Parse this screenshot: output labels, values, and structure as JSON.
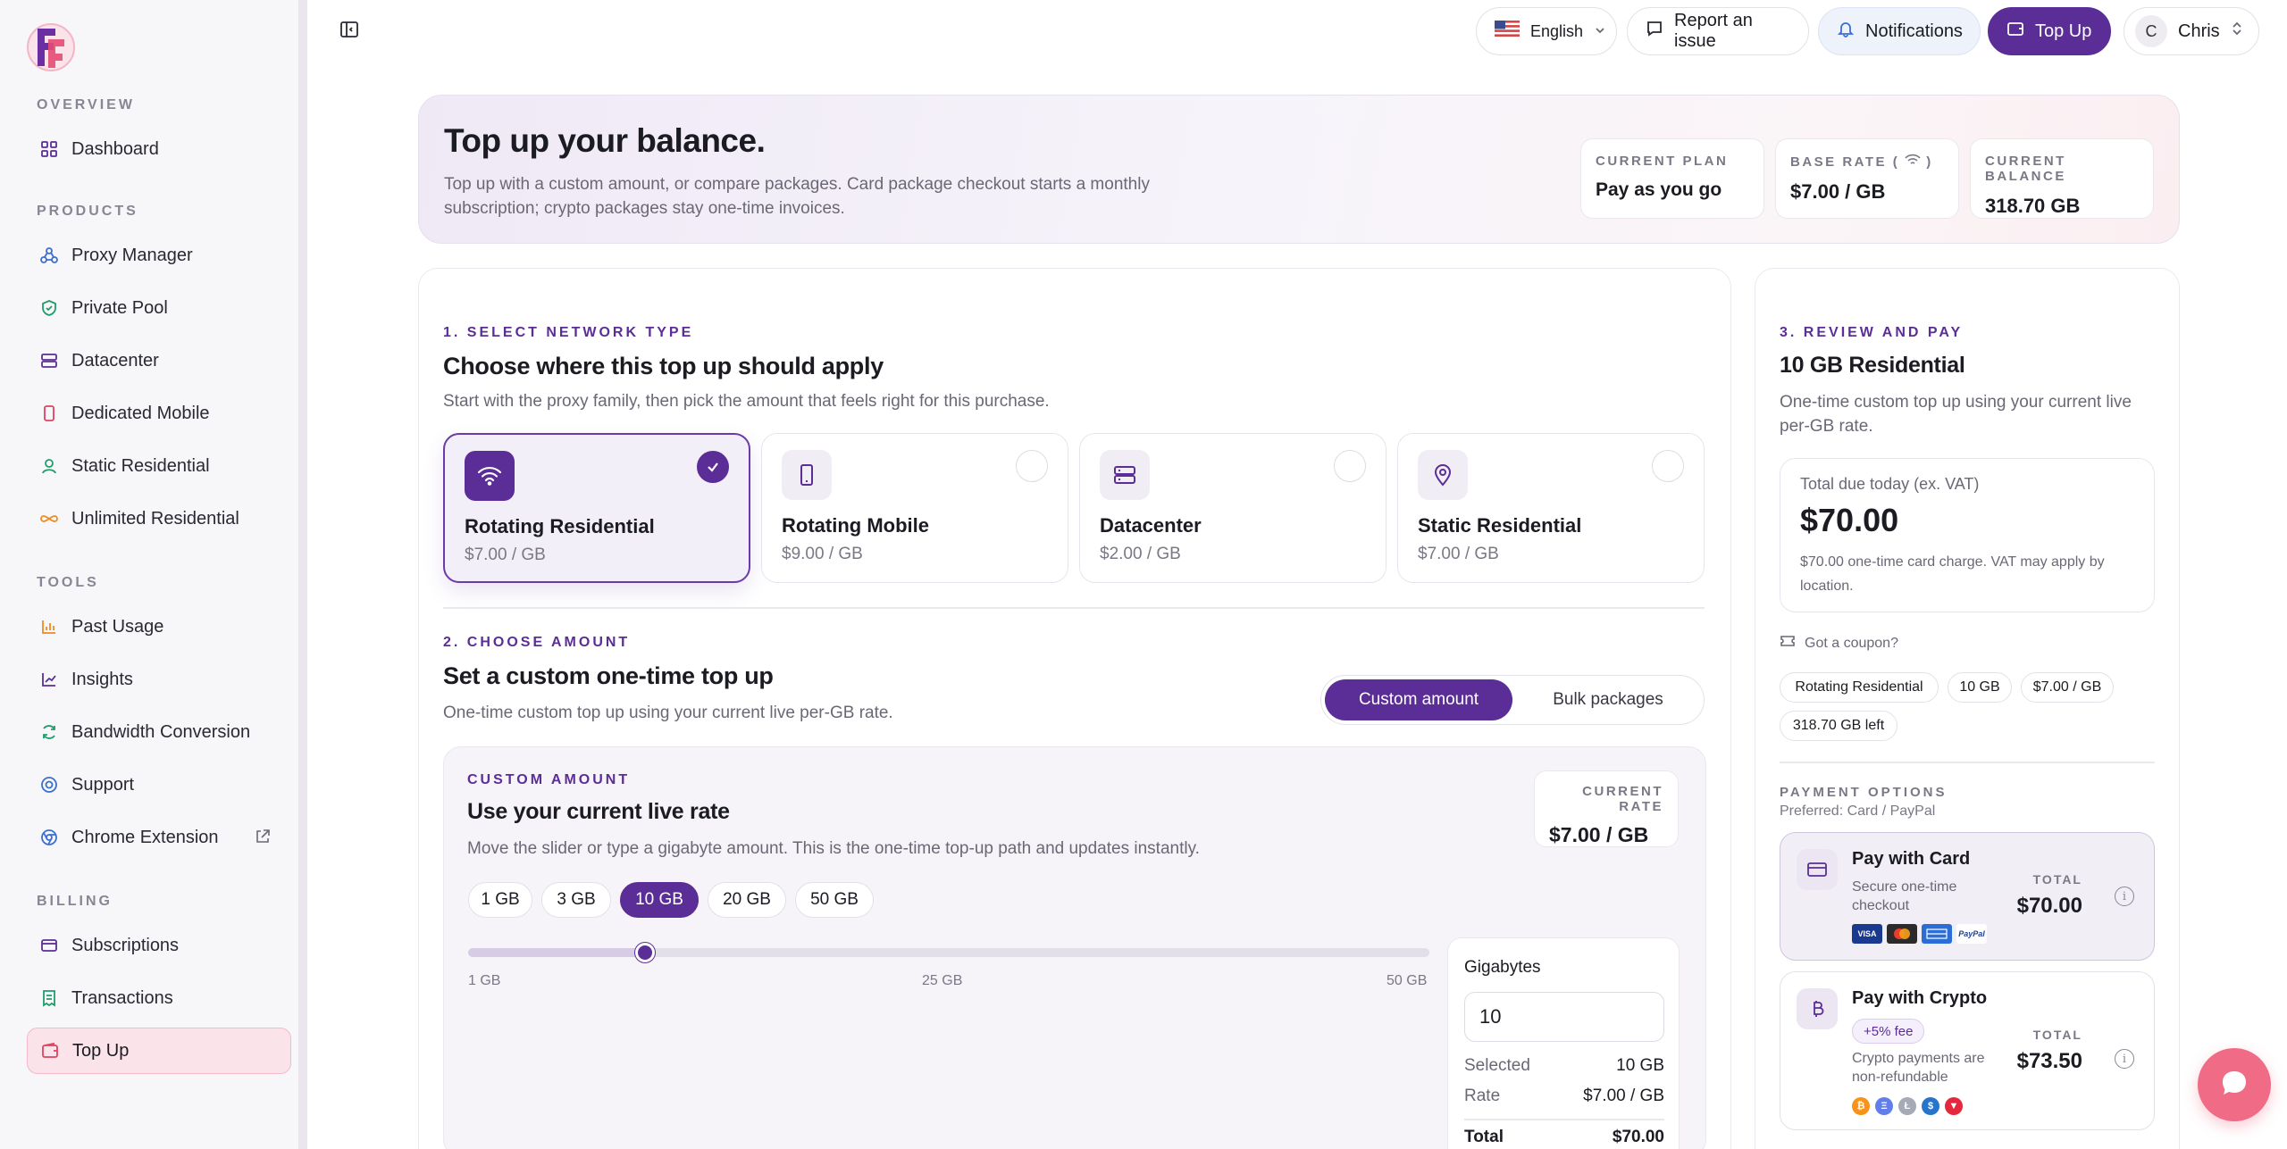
{
  "sidebar": {
    "sections": {
      "overview": "OVERVIEW",
      "products": "PRODUCTS",
      "tools": "TOOLS",
      "billing": "BILLING"
    },
    "items": {
      "dashboard": "Dashboard",
      "proxy_manager": "Proxy Manager",
      "private_pool": "Private Pool",
      "datacenter": "Datacenter",
      "dedicated_mobile": "Dedicated Mobile",
      "static_residential": "Static Residential",
      "unlimited_residential": "Unlimited Residential",
      "past_usage": "Past Usage",
      "insights": "Insights",
      "bandwidth_conversion": "Bandwidth Conversion",
      "support": "Support",
      "chrome_extension": "Chrome Extension",
      "subscriptions": "Subscriptions",
      "transactions": "Transactions",
      "top_up": "Top Up"
    },
    "active": "top_up"
  },
  "topbar": {
    "language": "English",
    "report": "Report an issue",
    "notifications": "Notifications",
    "top_up": "Top Up",
    "user_initial": "C",
    "user_name": "Chris"
  },
  "hero": {
    "title": "Top up your balance.",
    "description": "Top up with a custom amount, or compare packages. Card package checkout starts a monthly subscription; crypto packages stay one-time invoices.",
    "stats": {
      "plan_label": "CURRENT PLAN",
      "plan_value": "Pay as you go",
      "base_rate_label": "BASE RATE (",
      "base_rate_label_end": ")",
      "base_rate_value": "$7.00 / GB",
      "balance_label": "CURRENT BALANCE",
      "balance_value": "318.70 GB"
    }
  },
  "step1": {
    "label": "1. SELECT NETWORK TYPE",
    "title": "Choose where this top up should apply",
    "subtitle": "Start with the proxy family, then pick the amount that feels right for this purchase.",
    "networks": [
      {
        "name": "Rotating Residential",
        "price": "$7.00 / GB",
        "selected": true,
        "icon": "wifi-icon"
      },
      {
        "name": "Rotating Mobile",
        "price": "$9.00 / GB",
        "selected": false,
        "icon": "phone-icon"
      },
      {
        "name": "Datacenter",
        "price": "$2.00 / GB",
        "selected": false,
        "icon": "server-icon"
      },
      {
        "name": "Static Residential",
        "price": "$7.00 / GB",
        "selected": false,
        "icon": "map-pin-icon"
      }
    ]
  },
  "step2": {
    "label": "2. CHOOSE AMOUNT",
    "title": "Set a custom one-time top up",
    "subtitle": "One-time custom top up using your current live per-GB rate.",
    "tabs": {
      "custom": "Custom amount",
      "bulk": "Bulk packages",
      "active": "custom"
    },
    "custom": {
      "label": "CUSTOM AMOUNT",
      "title": "Use your current live rate",
      "subtitle": "Move the slider or type a gigabyte amount. This is the one-time top-up path and updates instantly.",
      "current_rate_label": "CURRENT RATE",
      "current_rate_value": "$7.00 / GB",
      "presets": [
        "1 GB",
        "3 GB",
        "10 GB",
        "20 GB",
        "50 GB"
      ],
      "selected_preset": "10 GB",
      "slider": {
        "min": 1,
        "max": 50,
        "value": 10,
        "min_label": "1 GB",
        "mid_label": "25 GB",
        "max_label": "50 GB"
      },
      "gigabytes_label": "Gigabytes",
      "gigabytes_value": "10",
      "summary": {
        "selected_label": "Selected",
        "selected_value": "10 GB",
        "rate_label": "Rate",
        "rate_value": "$7.00 / GB",
        "total_label": "Total",
        "total_value": "$70.00"
      }
    }
  },
  "step3": {
    "label": "3. REVIEW AND PAY",
    "title": "10 GB Residential",
    "subtitle": "One-time custom top up using your current live per-GB rate.",
    "due_label": "Total due today (ex. VAT)",
    "due_value": "$70.00",
    "due_note": "$70.00 one-time card charge. VAT may apply by location.",
    "coupon": "Got a coupon?",
    "tags": [
      "Rotating Residential",
      "10 GB",
      "$7.00 / GB",
      "318.70 GB left"
    ],
    "payment_label": "PAYMENT OPTIONS",
    "preferred": "Preferred: Card / PayPal",
    "card": {
      "title": "Pay with Card",
      "desc": "Secure one-time checkout",
      "total_label": "TOTAL",
      "total_value": "$70.00",
      "brands": [
        "VISA",
        "MC",
        "AMEX",
        "PayPal"
      ]
    },
    "crypto": {
      "title": "Pay with Crypto",
      "fee": "+5% fee",
      "desc": "Crypto payments are non-refundable",
      "total_label": "TOTAL",
      "total_value": "$73.50",
      "coins": [
        "bitcoin",
        "ethereum",
        "litecoin",
        "usdc",
        "tron"
      ]
    }
  },
  "colors": {
    "brand": "#5b2d96",
    "active_nav": "#fbe3ea",
    "chat": "#f06b85"
  }
}
